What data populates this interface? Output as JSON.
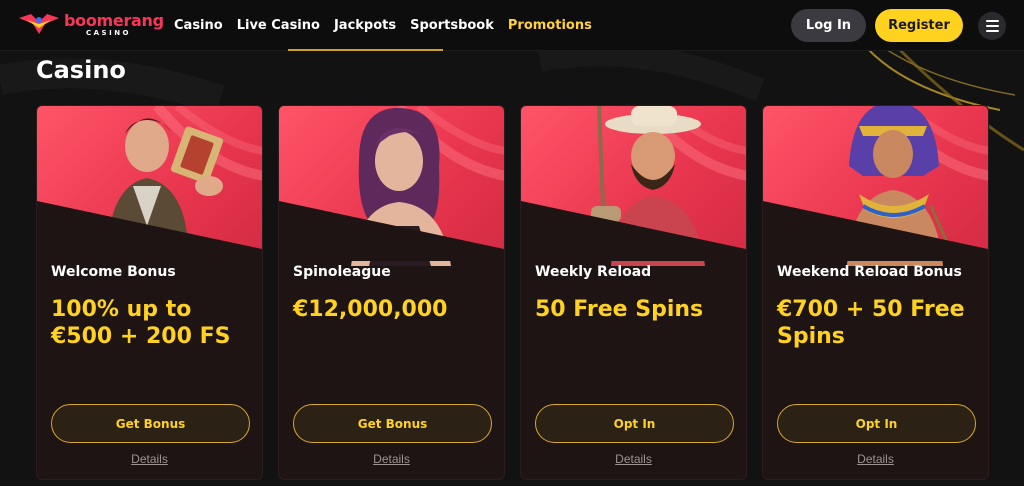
{
  "header": {
    "logo_word": "boomerang",
    "logo_sub": "CASINO",
    "nav": [
      {
        "label": "Casino",
        "active": false
      },
      {
        "label": "Live Casino",
        "active": false
      },
      {
        "label": "Jackpots",
        "active": false
      },
      {
        "label": "Sportsbook",
        "active": false
      },
      {
        "label": "Promotions",
        "active": true
      }
    ],
    "login_label": "Log In",
    "register_label": "Register",
    "menu_icon": "hamburger-menu-icon"
  },
  "colors": {
    "accent": "#ffd21f",
    "brand": "#f6375a",
    "card_red": "#e8364e",
    "background": "#121212"
  },
  "main": {
    "section_title": "Casino",
    "cards": [
      {
        "name": "Welcome Bonus",
        "offer": "100% up to €500 + 200 FS",
        "button": "Get Bonus",
        "details": "Details",
        "character": "adventurer-with-cards"
      },
      {
        "name": "Spinoleague",
        "offer": "€12,000,000",
        "button": "Get Bonus",
        "details": "Details",
        "character": "purple-haired-woman"
      },
      {
        "name": "Weekly Reload",
        "offer": "50 Free Spins",
        "button": "Opt In",
        "details": "Details",
        "character": "cowboy-fisherman"
      },
      {
        "name": "Weekend Reload Bonus",
        "offer": "€700 + 50 Free Spins",
        "button": "Opt In",
        "details": "Details",
        "character": "pharaoh"
      }
    ]
  }
}
